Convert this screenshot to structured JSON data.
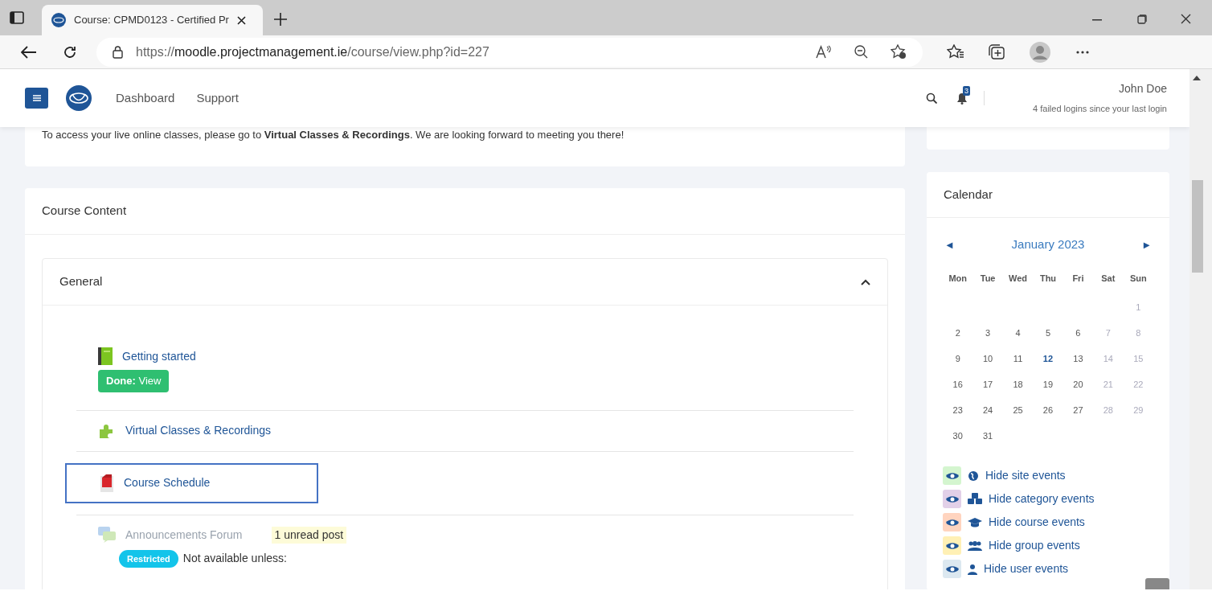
{
  "browser": {
    "tab_title": "Course: CPMD0123 - Certified Pr",
    "url": "https://**moodle.projectmanagement.ie**/course/view.php?id=227"
  },
  "header": {
    "nav": [
      "Dashboard",
      "Support"
    ],
    "notification_count": "3",
    "user_name": "John Doe",
    "login_note": "4 failed logins since your last login"
  },
  "notice": "To access your live online classes, please go to **Virtual Classes & Recordings**. We are looking forward to meeting you there!",
  "course": {
    "title": "Course Content",
    "section": {
      "title": "General",
      "expanded": true
    },
    "activities": [
      {
        "kind": "book",
        "name": "Getting started",
        "dimmed": false,
        "highlighted": false,
        "completion": "**Done:** View"
      },
      {
        "kind": "plugin",
        "name": "Virtual Classes & Recordings",
        "dimmed": false,
        "highlighted": false
      },
      {
        "kind": "pdf",
        "name": "Course Schedule",
        "dimmed": false,
        "highlighted": true
      },
      {
        "kind": "forum",
        "name": "Announcements Forum",
        "dimmed": true,
        "highlighted": false,
        "unread": "1 unread post",
        "restriction": {
          "badge": "Restricted",
          "text": "Not available unless:"
        }
      }
    ]
  },
  "calendar": {
    "title": "Calendar",
    "month": "January 2023",
    "prev": "◄",
    "next": "►",
    "weekdays": [
      "Mon",
      "Tue",
      "Wed",
      "Thu",
      "Fri",
      "Sat",
      "Sun"
    ],
    "weeks": [
      {
        "kind": "first",
        "days": [
          {
            "day": "1",
            "weekend": true,
            "today": false
          }
        ]
      },
      {
        "kind": "regular",
        "days": [
          {
            "day": "2",
            "weekend": false,
            "today": false
          },
          {
            "day": "3",
            "weekend": false,
            "today": false
          },
          {
            "day": "4",
            "weekend": false,
            "today": false
          },
          {
            "day": "5",
            "weekend": false,
            "today": false
          },
          {
            "day": "6",
            "weekend": false,
            "today": false
          },
          {
            "day": "7",
            "weekend": true,
            "today": false
          },
          {
            "day": "8",
            "weekend": true,
            "today": false
          }
        ]
      },
      {
        "kind": "regular",
        "days": [
          {
            "day": "9",
            "weekend": false,
            "today": false
          },
          {
            "day": "10",
            "weekend": false,
            "today": false
          },
          {
            "day": "11",
            "weekend": false,
            "today": false
          },
          {
            "day": "12",
            "weekend": false,
            "today": true
          },
          {
            "day": "13",
            "weekend": false,
            "today": false
          },
          {
            "day": "14",
            "weekend": true,
            "today": false
          },
          {
            "day": "15",
            "weekend": true,
            "today": false
          }
        ]
      },
      {
        "kind": "regular",
        "days": [
          {
            "day": "16",
            "weekend": false,
            "today": false
          },
          {
            "day": "17",
            "weekend": false,
            "today": false
          },
          {
            "day": "18",
            "weekend": false,
            "today": false
          },
          {
            "day": "19",
            "weekend": false,
            "today": false
          },
          {
            "day": "20",
            "weekend": false,
            "today": false
          },
          {
            "day": "21",
            "weekend": true,
            "today": false
          },
          {
            "day": "22",
            "weekend": true,
            "today": false
          }
        ]
      },
      {
        "kind": "regular",
        "days": [
          {
            "day": "23",
            "weekend": false,
            "today": false
          },
          {
            "day": "24",
            "weekend": false,
            "today": false
          },
          {
            "day": "25",
            "weekend": false,
            "today": false
          },
          {
            "day": "26",
            "weekend": false,
            "today": false
          },
          {
            "day": "27",
            "weekend": false,
            "today": false
          },
          {
            "day": "28",
            "weekend": true,
            "today": false
          },
          {
            "day": "29",
            "weekend": true,
            "today": false
          }
        ]
      },
      {
        "kind": "regular",
        "days": [
          {
            "day": "30",
            "weekend": false,
            "today": false
          },
          {
            "day": "31",
            "weekend": false,
            "today": false
          }
        ]
      }
    ],
    "legend": [
      {
        "kind": "site",
        "label": "Hide site events",
        "color": "#d4f5cf"
      },
      {
        "kind": "category",
        "label": "Hide category events",
        "color": "#e2d0e8"
      },
      {
        "kind": "course",
        "label": "Hide course events",
        "color": "#ffd4bf"
      },
      {
        "kind": "group",
        "label": "Hide group events",
        "color": "#fff0b5"
      },
      {
        "kind": "user",
        "label": "Hide user events",
        "color": "#dce8f0"
      }
    ]
  }
}
